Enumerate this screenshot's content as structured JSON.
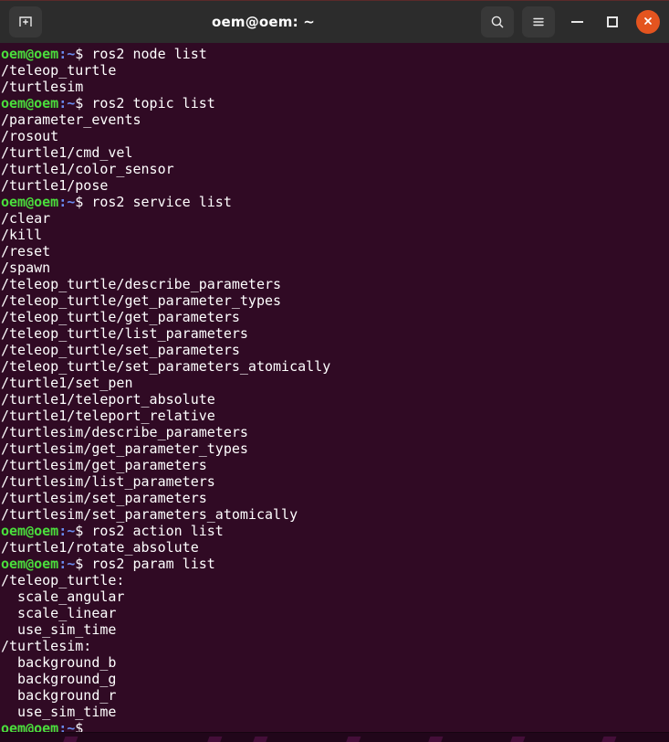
{
  "window": {
    "title": "oem@oem: ~",
    "colors": {
      "titlebar_bg": "#2c2c2c",
      "terminal_bg": "#300a24",
      "prompt_user": "#4ade3c",
      "prompt_path": "#6a8cf0",
      "text": "#ffffff",
      "close_button": "#e4541f"
    }
  },
  "titlebar": {
    "new_tab_icon": "new-tab-icon",
    "search_icon": "search-icon",
    "menu_icon": "hamburger-menu-icon",
    "minimize_icon": "minimize-icon",
    "maximize_icon": "maximize-icon",
    "close_icon": "close-icon"
  },
  "terminal": {
    "prompt": {
      "user": "oem@oem",
      "path": ":~",
      "symbol": "$"
    },
    "lines": [
      {
        "type": "prompt",
        "command": " ros2 node list"
      },
      {
        "type": "output",
        "text": "/teleop_turtle"
      },
      {
        "type": "output",
        "text": "/turtlesim"
      },
      {
        "type": "prompt",
        "command": " ros2 topic list"
      },
      {
        "type": "output",
        "text": "/parameter_events"
      },
      {
        "type": "output",
        "text": "/rosout"
      },
      {
        "type": "output",
        "text": "/turtle1/cmd_vel"
      },
      {
        "type": "output",
        "text": "/turtle1/color_sensor"
      },
      {
        "type": "output",
        "text": "/turtle1/pose"
      },
      {
        "type": "prompt",
        "command": " ros2 service list"
      },
      {
        "type": "output",
        "text": "/clear"
      },
      {
        "type": "output",
        "text": "/kill"
      },
      {
        "type": "output",
        "text": "/reset"
      },
      {
        "type": "output",
        "text": "/spawn"
      },
      {
        "type": "output",
        "text": "/teleop_turtle/describe_parameters"
      },
      {
        "type": "output",
        "text": "/teleop_turtle/get_parameter_types"
      },
      {
        "type": "output",
        "text": "/teleop_turtle/get_parameters"
      },
      {
        "type": "output",
        "text": "/teleop_turtle/list_parameters"
      },
      {
        "type": "output",
        "text": "/teleop_turtle/set_parameters"
      },
      {
        "type": "output",
        "text": "/teleop_turtle/set_parameters_atomically"
      },
      {
        "type": "output",
        "text": "/turtle1/set_pen"
      },
      {
        "type": "output",
        "text": "/turtle1/teleport_absolute"
      },
      {
        "type": "output",
        "text": "/turtle1/teleport_relative"
      },
      {
        "type": "output",
        "text": "/turtlesim/describe_parameters"
      },
      {
        "type": "output",
        "text": "/turtlesim/get_parameter_types"
      },
      {
        "type": "output",
        "text": "/turtlesim/get_parameters"
      },
      {
        "type": "output",
        "text": "/turtlesim/list_parameters"
      },
      {
        "type": "output",
        "text": "/turtlesim/set_parameters"
      },
      {
        "type": "output",
        "text": "/turtlesim/set_parameters_atomically"
      },
      {
        "type": "prompt",
        "command": " ros2 action list"
      },
      {
        "type": "output",
        "text": "/turtle1/rotate_absolute"
      },
      {
        "type": "prompt",
        "command": " ros2 param list"
      },
      {
        "type": "output",
        "text": "/teleop_turtle:"
      },
      {
        "type": "output",
        "text": "  scale_angular"
      },
      {
        "type": "output",
        "text": "  scale_linear"
      },
      {
        "type": "output",
        "text": "  use_sim_time"
      },
      {
        "type": "output",
        "text": "/turtlesim:"
      },
      {
        "type": "output",
        "text": "  background_b"
      },
      {
        "type": "output",
        "text": "  background_g"
      },
      {
        "type": "output",
        "text": "  background_r"
      },
      {
        "type": "output",
        "text": "  use_sim_time"
      },
      {
        "type": "prompt",
        "command": ""
      }
    ]
  }
}
